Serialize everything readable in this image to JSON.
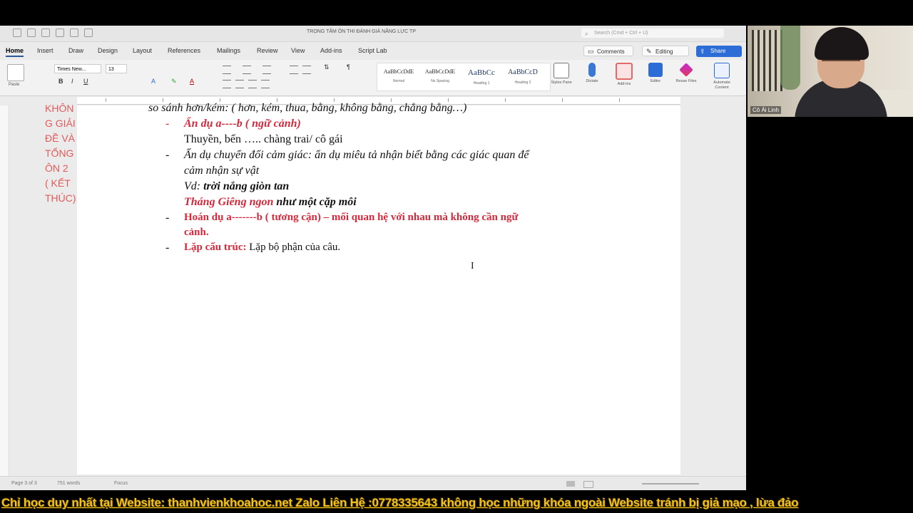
{
  "window": {
    "doc_title": "TRỌNG TÂM ÔN THI ĐÁNH GIÁ NĂNG LỰC TP",
    "search_placeholder": "Search (Cmd + Ctrl + U)"
  },
  "menu": [
    "Home",
    "Insert",
    "Draw",
    "Design",
    "Layout",
    "References",
    "Mailings",
    "Review",
    "View",
    "Add-ins",
    "Script Lab"
  ],
  "top_buttons": {
    "comments": "Comments",
    "editing": "Editing",
    "share": "Share"
  },
  "ribbon": {
    "paste": "Paste",
    "font_name": "Times New...",
    "font_size": "13",
    "styles": [
      {
        "preview": "AaBbCcDdE",
        "label": "Normal"
      },
      {
        "preview": "AaBbCcDdE",
        "label": "No Spacing"
      },
      {
        "preview": "AaBbCc",
        "label": "Heading 1"
      },
      {
        "preview": "AaBbCcD",
        "label": "Heading 2"
      }
    ],
    "tools": [
      {
        "label": "Styles Pane"
      },
      {
        "label": "Dictate"
      },
      {
        "label": "Add-ins"
      },
      {
        "label": "Editor"
      },
      {
        "label": "Reuse Files"
      },
      {
        "label": "Automate Content"
      }
    ]
  },
  "document": {
    "cut_line": "so sánh hơn/kém: ( hơn, kém, thua, bằng, không bằng, chẳng bằng…)",
    "item1_heading": "Ẩn dụ a----b ( ngữ cảnh)",
    "item1_example": "Thuyền, bến ….. chàng trai/ cô gái",
    "item2_heading": "Ẩn dụ chuyển đổi cảm giác:",
    "item2_desc_a": " ẩn dụ miêu tả nhận biết bằng các giác quan để",
    "item2_desc_b": "cảm nhận sự vật",
    "vd_label": "Vd: ",
    "vd_text": "trời nắng giòn tan",
    "quote_red": "Tháng Giêng ngon",
    "quote_black": " như một cặp môi",
    "item3_line1": "Hoán dụ a-------b ( tương cận) – mối quan hệ với nhau mà không cần ngữ",
    "item3_line2": "cảnh.",
    "item4_heading": "Lặp cấu trúc:",
    "item4_text": " Lặp bộ phận của câu."
  },
  "margin_note": [
    "KHÔN",
    "G GIẢI",
    "ĐỀ VÀ",
    "TỔNG",
    "ÔN 2",
    "( KẾT",
    "THÚC)"
  ],
  "statusbar": {
    "page": "Page 3 of 3",
    "words": "751 words",
    "focus": "Focus"
  },
  "webcam": {
    "name": "Cô Ái Linh"
  },
  "banner": "Chỉ học duy nhất tại Website: thanhvienkhoahoc.net  Zalo Liên Hệ :0778335643 không học những khóa ngoài Website tránh bị giả mạo , lừa đảo"
}
